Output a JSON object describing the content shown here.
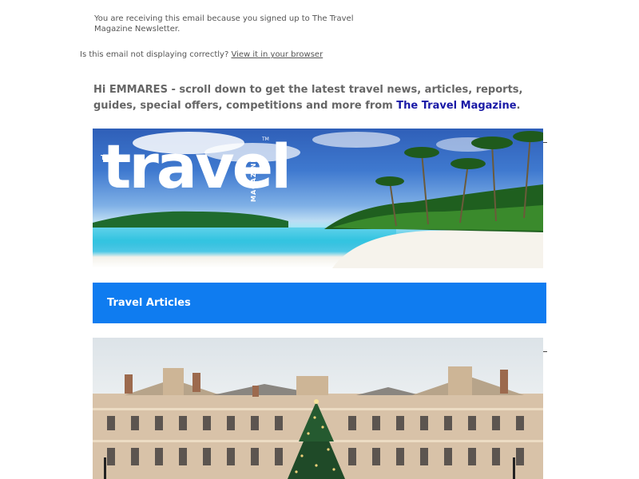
{
  "notice": "You are receiving this email because you signed up to The Travel Magazine Newsletter.",
  "display_line": {
    "prefix": "Is this email not displaying correctly?",
    "link": "View it in your browser"
  },
  "greeting": {
    "text": "Hi EMMARES - scroll down to get the latest travel news, articles, reports, guides, special offers, competitions and more from",
    "brand": "The Travel Magazine",
    "suffix": "."
  },
  "hero": {
    "logo_the": "THE",
    "logo_word": "travel",
    "logo_magazine": "MAGAZINE",
    "logo_tm": "TM"
  },
  "section": {
    "title": "Travel Articles"
  },
  "colors": {
    "section_bar": "#0f7cf0",
    "brand_link": "#1a1aa6",
    "text_gray": "#555555"
  },
  "icons": [
    "tropical-beach-banner",
    "palace-christmas-tree-photo"
  ]
}
